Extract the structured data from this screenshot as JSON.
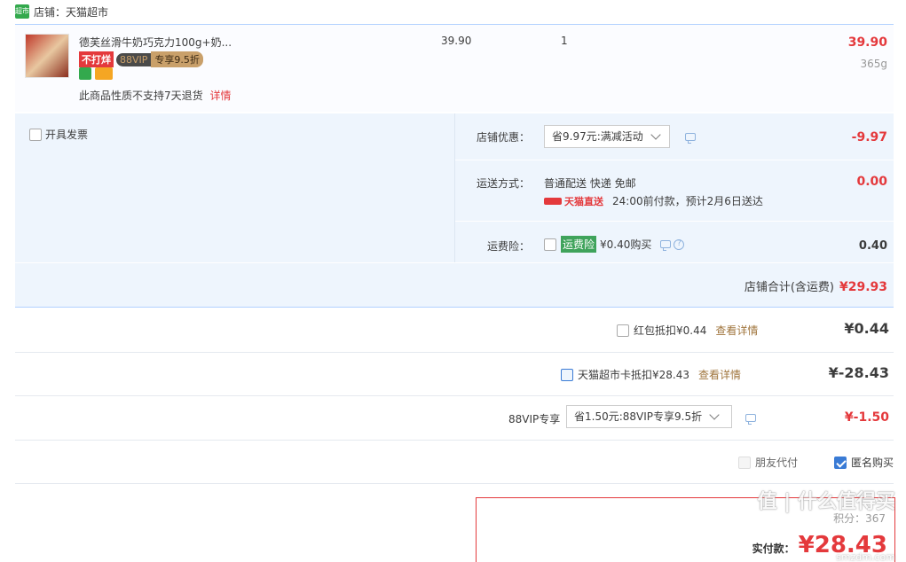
{
  "shop": {
    "logo_text": "超市",
    "name": "店铺：天猫超市"
  },
  "item": {
    "title": "德芙丝滑牛奶巧克力100g+奶...",
    "badge_no_discount": "不打烊",
    "badge_vip": "88VIP",
    "badge_vip_discount": "专享9.5折",
    "unit_price": "39.90",
    "quantity": "1",
    "subtotal": "39.90",
    "weight": "365g",
    "return_note": "此商品性质不支持7天退货",
    "return_link": "详情"
  },
  "invoice": {
    "label": "开具发票"
  },
  "shop_discount": {
    "label": "店铺优惠：",
    "selected": "省9.97元:满减活动",
    "amount": "-9.97"
  },
  "shipping": {
    "label": "运送方式：",
    "method": "普通配送 快递 免邮",
    "direct_label": "天猫直送",
    "eta": "24:00前付款，预计2月6日送达",
    "amount": "0.00"
  },
  "insurance": {
    "label": "运费险：",
    "tag": "运费险",
    "price": "¥0.40购买",
    "amount": "0.40"
  },
  "shop_total": {
    "label": "店铺合计(含运费)",
    "amount": "¥29.93"
  },
  "red_packet": {
    "label": "红包抵扣¥0.44",
    "link": "查看详情",
    "amount": "¥0.44"
  },
  "market_card": {
    "label": "天猫超市卡抵扣¥28.43",
    "link": "查看详情",
    "amount": "¥-28.43"
  },
  "vip88": {
    "label": "88VIP专享",
    "selected": "省1.50元:88VIP专享9.5折",
    "amount": "¥-1.50"
  },
  "options": {
    "friend_pay": "朋友代付",
    "anonymous": "匿名购买"
  },
  "summary": {
    "points_text": "积分：367",
    "pay_label": "实付款：",
    "pay_amount": "¥28.43"
  },
  "watermark": {
    "text": "值 | 什么值得买",
    "url": "smzdm.com"
  },
  "colors": {
    "accent_red": "#e4393c",
    "panel_bg": "#eef5fd",
    "link_brown": "#a0753d",
    "vip_dark": "#4a4a4a",
    "vip_gold": "#c9a06a"
  }
}
